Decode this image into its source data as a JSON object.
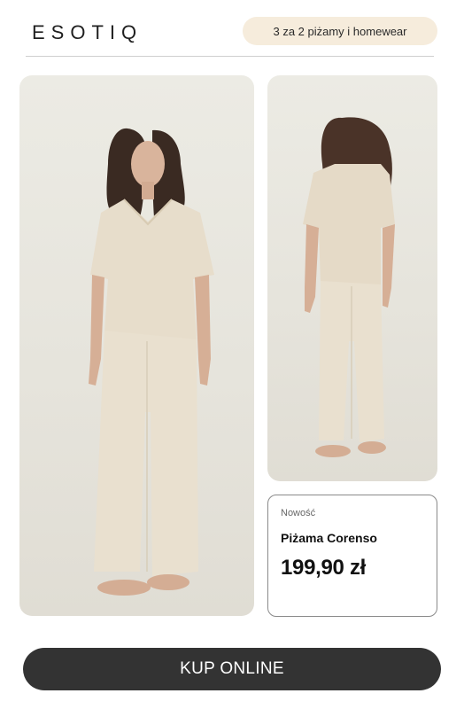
{
  "header": {
    "logo_text": "ESOTIQ",
    "promo_label": "3 za 2 piżamy i homewear"
  },
  "product": {
    "badge": "Nowość",
    "name": "Piżama Corenso",
    "price": "199,90 zł"
  },
  "cta": {
    "label": "KUP ONLINE"
  },
  "colors": {
    "cta_background": "#333333",
    "promo_background": "#f6ecdc",
    "photo_background": "#e6e4dc",
    "garment": "#e4d9c6"
  }
}
